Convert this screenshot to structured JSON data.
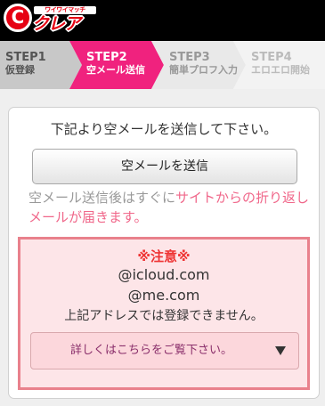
{
  "header": {
    "logo_mark": "C",
    "logo_tagline": "ワイワイマッチ",
    "logo_name": "クレア"
  },
  "steps": [
    {
      "num": "STEP1",
      "label": "仮登録",
      "state": "done"
    },
    {
      "num": "STEP2",
      "label": "空メール送信",
      "state": "current"
    },
    {
      "num": "STEP3",
      "label": "簡単プロフ入力",
      "state": "upcoming"
    },
    {
      "num": "STEP4",
      "label": "エロエロ開始",
      "state": "upcoming"
    }
  ],
  "main": {
    "intro": "下記より空メールを送信して下さい。",
    "send_button": "空メールを送信",
    "note_prefix": "空メール送信後はすぐに",
    "note_highlight": "サイトからの折り返しメールが届きます。",
    "warning": {
      "title": "※注意※",
      "domain1": "@icloud.com",
      "domain2": "@me.com",
      "message": "上記アドレスでは登録できません。",
      "details_label": "詳しくはこちらをご覧下さい。",
      "details_icon": "triangle-down-icon"
    }
  },
  "colors": {
    "brand": "#e60012",
    "step_current": "#f0227e",
    "step_done": "#c8c8c8",
    "step_upcoming": "#e9e9e9",
    "highlight": "#f0678a",
    "warning_border": "#e9818c",
    "warning_bg": "#fde5e8"
  }
}
